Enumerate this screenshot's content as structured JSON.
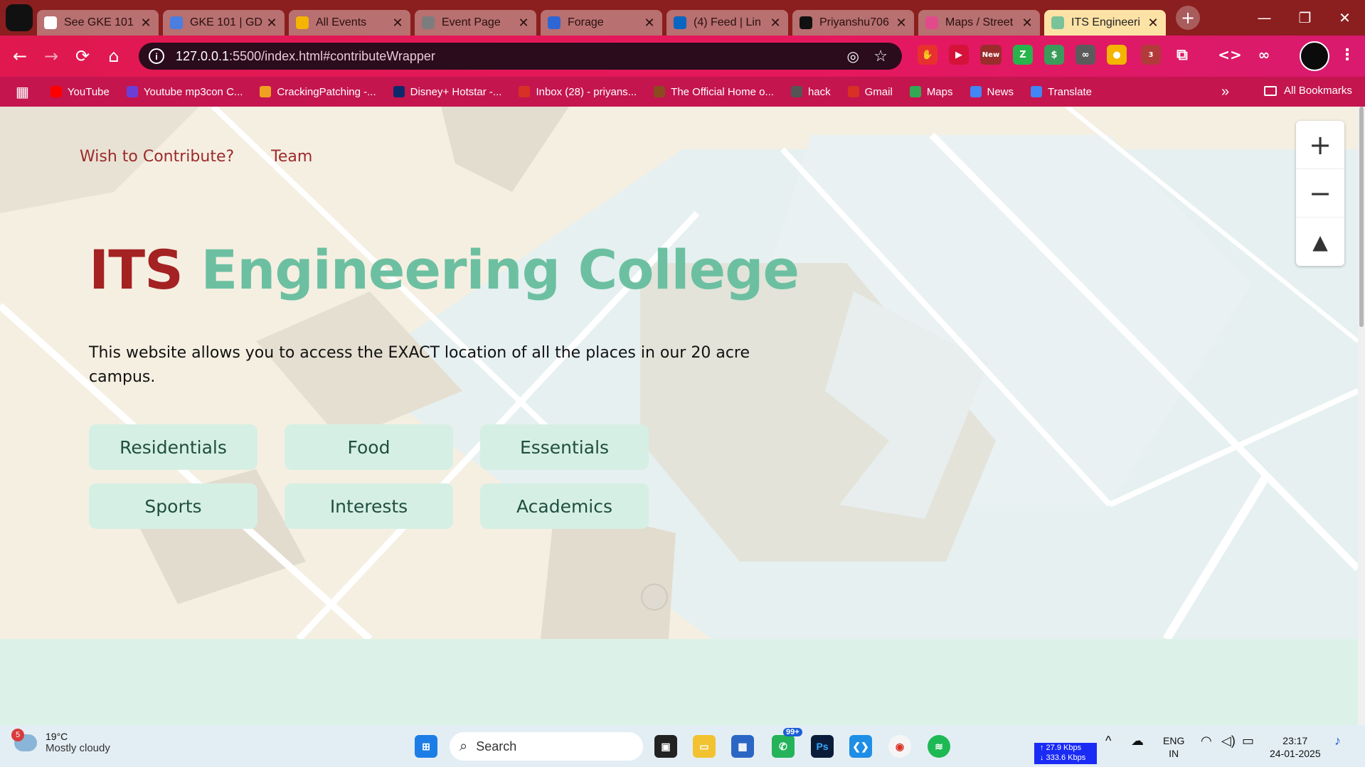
{
  "browser": {
    "tabs": [
      {
        "title": "See GKE 101",
        "favicon_color": "#ffffff"
      },
      {
        "title": "GKE 101 | GD",
        "favicon_color": "#4a7ee0"
      },
      {
        "title": "All Events",
        "favicon_color": "#f4b400"
      },
      {
        "title": "Event Page",
        "favicon_color": "#7d7d7d"
      },
      {
        "title": "Forage",
        "favicon_color": "#2f66d6"
      },
      {
        "title": "(4) Feed | Lin",
        "favicon_color": "#0a66c2"
      },
      {
        "title": "Priyanshu706",
        "favicon_color": "#111111"
      },
      {
        "title": "Maps / Street",
        "favicon_color": "#e24b8b"
      },
      {
        "title": "ITS Engineeri",
        "favicon_color": "#7ac29a",
        "active": true
      }
    ],
    "new_tab_symbol": "+",
    "close_symbol": "✕",
    "window_controls": {
      "minimize": "—",
      "restore": "❐",
      "close": "✕"
    },
    "url_host": "127.0.0.1",
    "url_path": ":5500/index.html#contributeWrapper",
    "ext_new_badge": "New",
    "ext_count_badge": "3",
    "bookmarks": [
      {
        "label": "YouTube",
        "color": "#ff0000"
      },
      {
        "label": "Youtube mp3con C...",
        "color": "#6b3fd6"
      },
      {
        "label": "CrackingPatching -...",
        "color": "#f0a020"
      },
      {
        "label": "Disney+ Hotstar -...",
        "color": "#0c2a6b"
      },
      {
        "label": "Inbox (28) - priyans...",
        "color": "#d93025"
      },
      {
        "label": "The Official Home o...",
        "color": "#8b4b1f"
      },
      {
        "label": "hack",
        "color": "#555555"
      },
      {
        "label": "Gmail",
        "color": "#d93025"
      },
      {
        "label": "Maps",
        "color": "#34a853"
      },
      {
        "label": "News",
        "color": "#4285f4"
      },
      {
        "label": "Translate",
        "color": "#4285f4"
      }
    ],
    "all_bookmarks": "All Bookmarks"
  },
  "site": {
    "nav": {
      "contribute": "Wish to Contribute?",
      "team": "Team"
    },
    "heading_part1": "ITS",
    "heading_part2": "Engineering College",
    "description": "This website allows you to access the EXACT location of all the places in our 20 acre campus.",
    "categories": [
      "Residentials",
      "Food",
      "Essentials",
      "Sports",
      "Interests",
      "Academics"
    ],
    "map_controls": {
      "zoom_in": "+",
      "zoom_out": "−",
      "compass": "▲"
    }
  },
  "taskbar": {
    "weather_temp": "19°C",
    "weather_desc": "Mostly cloudy",
    "weather_badge": "5",
    "search_placeholder": "Search",
    "whatsapp_badge": "99+",
    "net_up": "↑ 27.9 Kbps",
    "net_down": "↓ 333.6 Kbps",
    "lang": "ENG",
    "region": "IN",
    "time": "23:17",
    "date": "24-01-2025"
  }
}
